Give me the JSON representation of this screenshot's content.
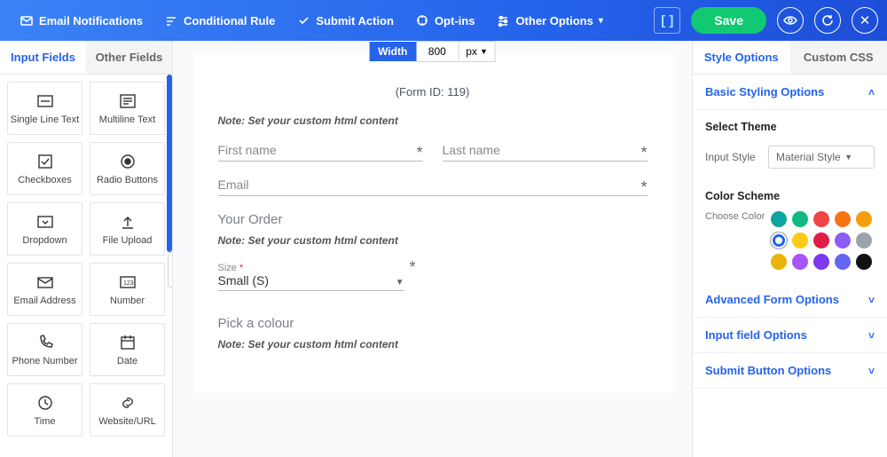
{
  "topbar": {
    "email_notifications": "Email Notifications",
    "conditional_rule": "Conditional Rule",
    "submit_action": "Submit Action",
    "optins": "Opt-ins",
    "other_options": "Other Options",
    "save": "Save"
  },
  "left_tabs": {
    "input_fields": "Input Fields",
    "other_fields": "Other Fields"
  },
  "tiles": {
    "single_line_text": "Single Line Text",
    "multiline_text": "Multiline Text",
    "checkboxes": "Checkboxes",
    "radio_buttons": "Radio Buttons",
    "dropdown": "Dropdown",
    "file_upload": "File Upload",
    "email_address": "Email Address",
    "number": "Number",
    "phone_number": "Phone Number",
    "date": "Date",
    "time": "Time",
    "website_url": "Website/URL"
  },
  "canvas": {
    "width_label": "Width",
    "width_value": "800",
    "width_unit": "px",
    "form_id": "(Form ID: 119)",
    "note": "Note: Set your custom html content",
    "first_name": "First name",
    "last_name": "Last name",
    "email": "Email",
    "your_order": "Your Order",
    "size_label": "Size",
    "size_value": "Small (S)",
    "pick_color": "Pick a colour"
  },
  "right_tabs": {
    "style_options": "Style Options",
    "custom_css": "Custom CSS"
  },
  "right": {
    "basic_styling": "Basic Styling Options",
    "select_theme": "Select Theme",
    "input_style_label": "Input Style",
    "input_style_value": "Material Style",
    "color_scheme": "Color Scheme",
    "choose_color": "Choose Color",
    "advanced_form": "Advanced Form Options",
    "input_field_opts": "Input field Options",
    "submit_button_opts": "Submit Button Options"
  },
  "swatches": [
    "#0ea5a0",
    "#10b981",
    "#ef4444",
    "#f97316",
    "#f59e0b",
    "#2563eb",
    "#facc15",
    "#e11d48",
    "#8b5cf6",
    "#9ca3af",
    "#eab308",
    "#a855f7",
    "#7c3aed",
    "#6366f1",
    "#111111"
  ]
}
